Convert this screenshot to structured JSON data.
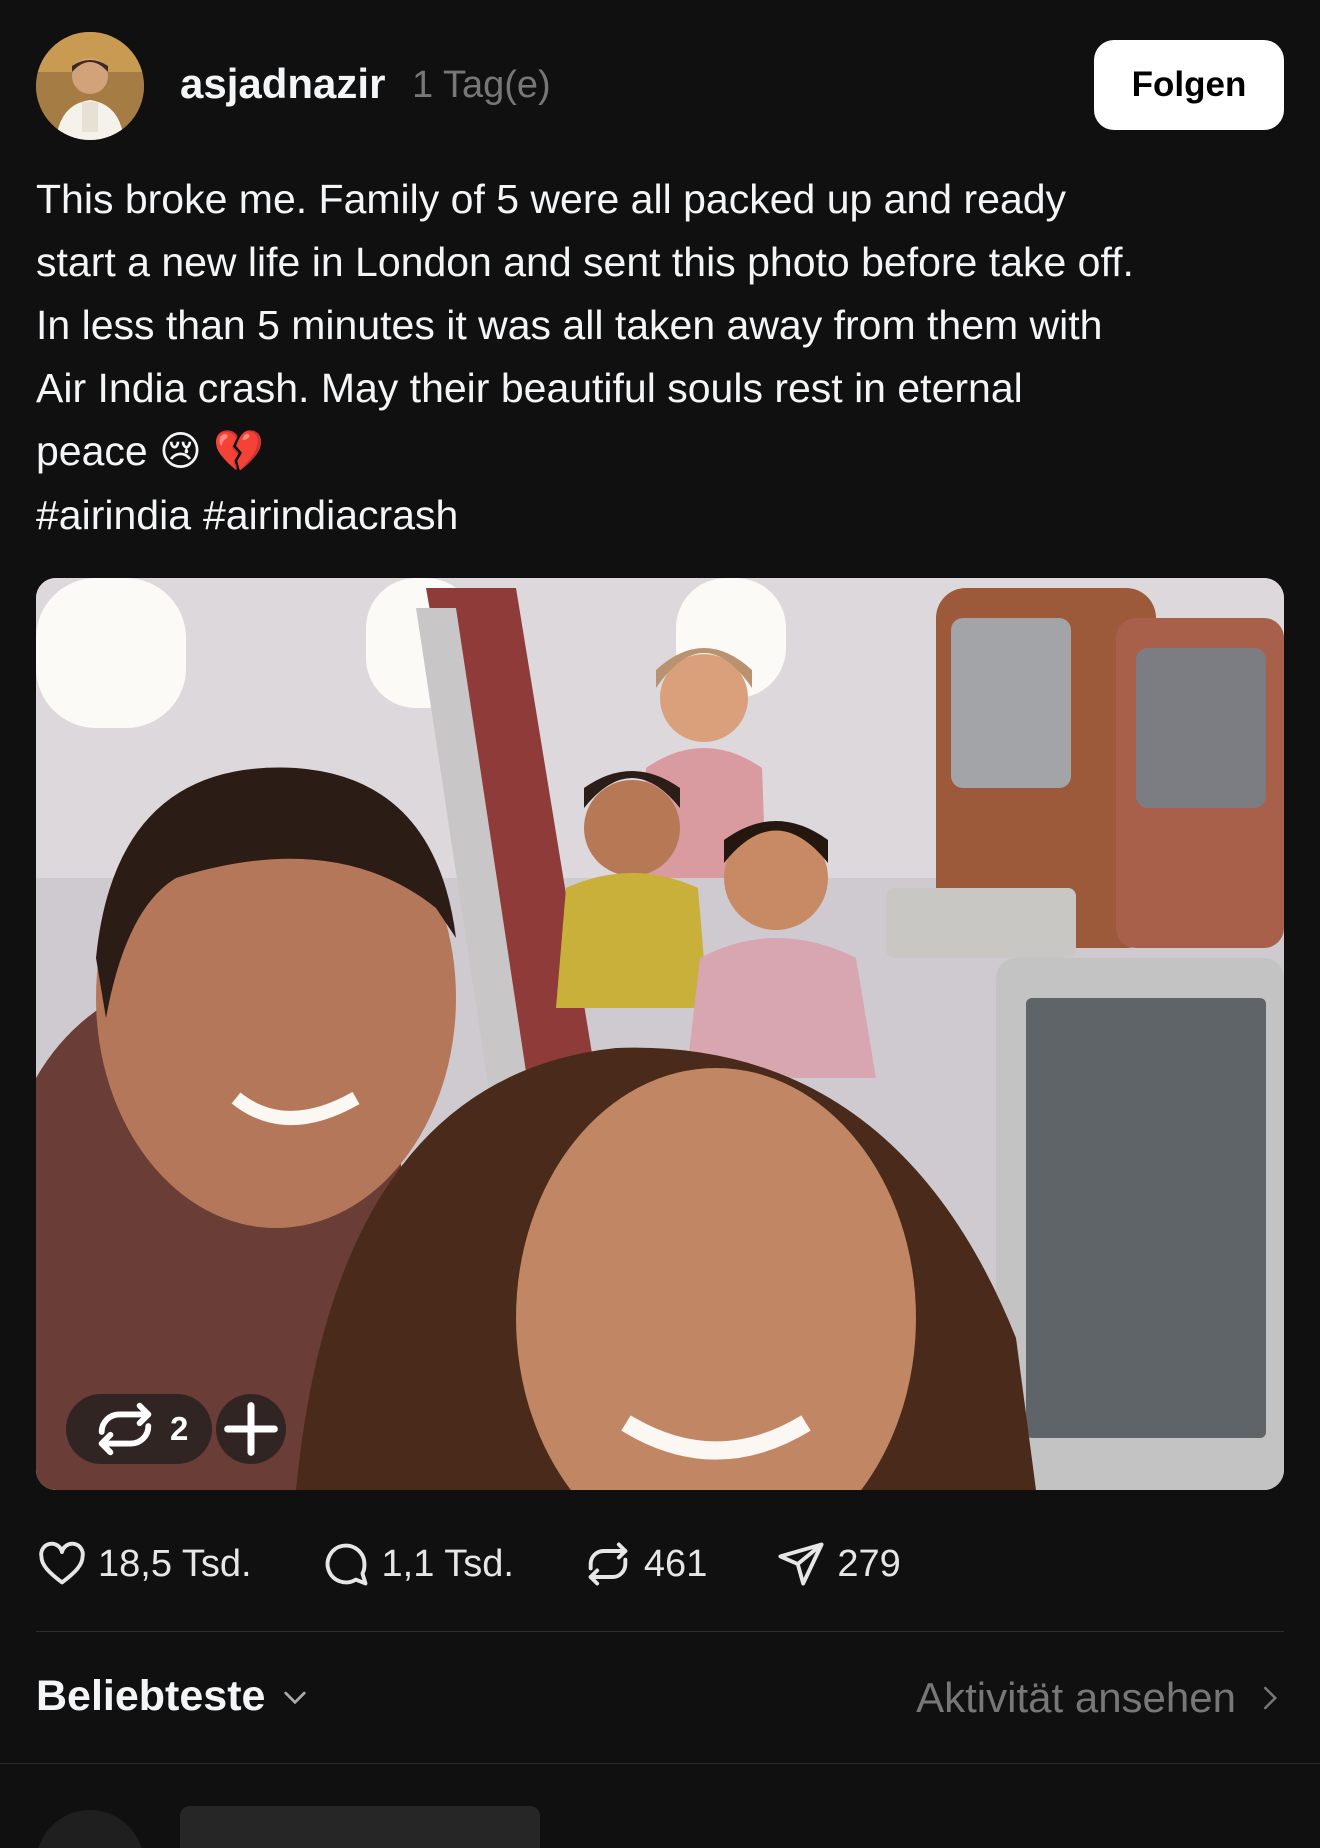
{
  "post": {
    "username": "asjadnazir",
    "timestamp": "1 Tag(e)",
    "follow_label": "Folgen",
    "caption_lines": [
      "This broke me. Family of 5 were all packed up and ready",
      "start a new life in London and sent this photo before take off.",
      "In less than 5 minutes it was all taken away from them with",
      "Air India crash. May their beautiful souls rest in eternal",
      "peace 😢 💔"
    ],
    "hashtags": [
      "#airindia",
      "#airindiacrash"
    ],
    "media": {
      "repost_count": "2",
      "add_icon": "plus-icon"
    },
    "actions": {
      "likes": "18,5 Tsd.",
      "comments": "1,1 Tsd.",
      "reposts": "461",
      "shares": "279"
    }
  },
  "replies": {
    "sort_label": "Beliebteste",
    "activity_label": "Aktivität ansehen"
  },
  "icons": [
    "heart-icon",
    "comment-icon",
    "repost-icon",
    "share-icon",
    "chevron-down-icon",
    "chevron-right-icon",
    "plus-icon"
  ],
  "colors": {
    "background": "#101010",
    "text": "#f3f5f7",
    "secondary_text": "#777777",
    "button_bg": "#ffffff"
  }
}
